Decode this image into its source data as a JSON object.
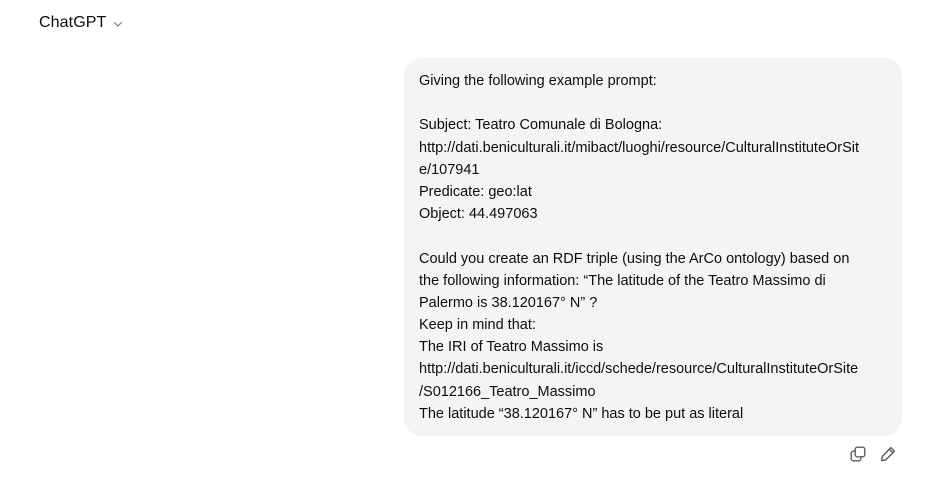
{
  "header": {
    "title": "ChatGPT",
    "model_menu_icon": "chevron-down-icon"
  },
  "message": {
    "lines": [
      "Giving the following example prompt:",
      "",
      "Subject: Teatro Comunale di Bologna:",
      "http://dati.beniculturali.it/mibact/luoghi/resource/CulturalInstituteOrSit",
      "e/107941",
      "Predicate: geo:lat",
      "Object: 44.497063",
      "",
      "Could you create an RDF triple (using the ArCo ontology) based on",
      "the following information: “The latitude of the Teatro Massimo di",
      "Palermo is 38.120167° N” ?",
      "Keep in mind that:",
      "The IRI of Teatro Massimo is",
      "http://dati.beniculturali.it/iccd/schede/resource/CulturalInstituteOrSite",
      "/S012166_Teatro_Massimo",
      "The latitude “38.120167° N” has to be put as literal"
    ]
  },
  "actions": {
    "copy_icon": "copy-icon",
    "edit_icon": "pencil-icon"
  },
  "colors": {
    "bubble_background": "#f4f4f4",
    "text": "#0d0d0d",
    "icon": "#5d5d5d"
  }
}
